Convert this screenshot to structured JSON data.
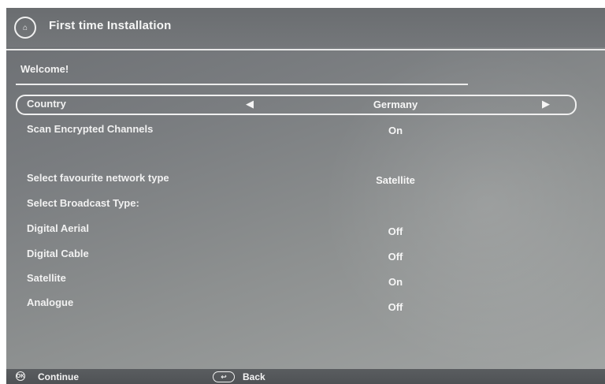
{
  "header": {
    "icon": "install-icon",
    "icon_glyph": "Install",
    "title": "First time Installation"
  },
  "welcome": "Welcome!",
  "settings": {
    "country": {
      "label": "Country",
      "value": "Germany"
    },
    "scan_encrypted": {
      "label": "Scan Encrypted Channels",
      "value": "On"
    },
    "network_type": {
      "label": "Select favourite network type",
      "value": "Satellite"
    },
    "broadcast_type_label": "Select Broadcast Type:",
    "digital_aerial": {
      "label": "Digital Aerial",
      "value": "Off"
    },
    "digital_cable": {
      "label": "Digital Cable",
      "value": "Off"
    },
    "satellite": {
      "label": "Satellite",
      "value": "On"
    },
    "analogue": {
      "label": "Analogue",
      "value": "Off"
    }
  },
  "footer": {
    "continue_label": "Continue",
    "back_label": "Back",
    "ok_icon": "ok-icon",
    "back_icon": "back-icon"
  },
  "colors": {
    "background": "#7a7d80",
    "text": "#f2f2f2",
    "highlight_border": "#f0f0f0"
  }
}
